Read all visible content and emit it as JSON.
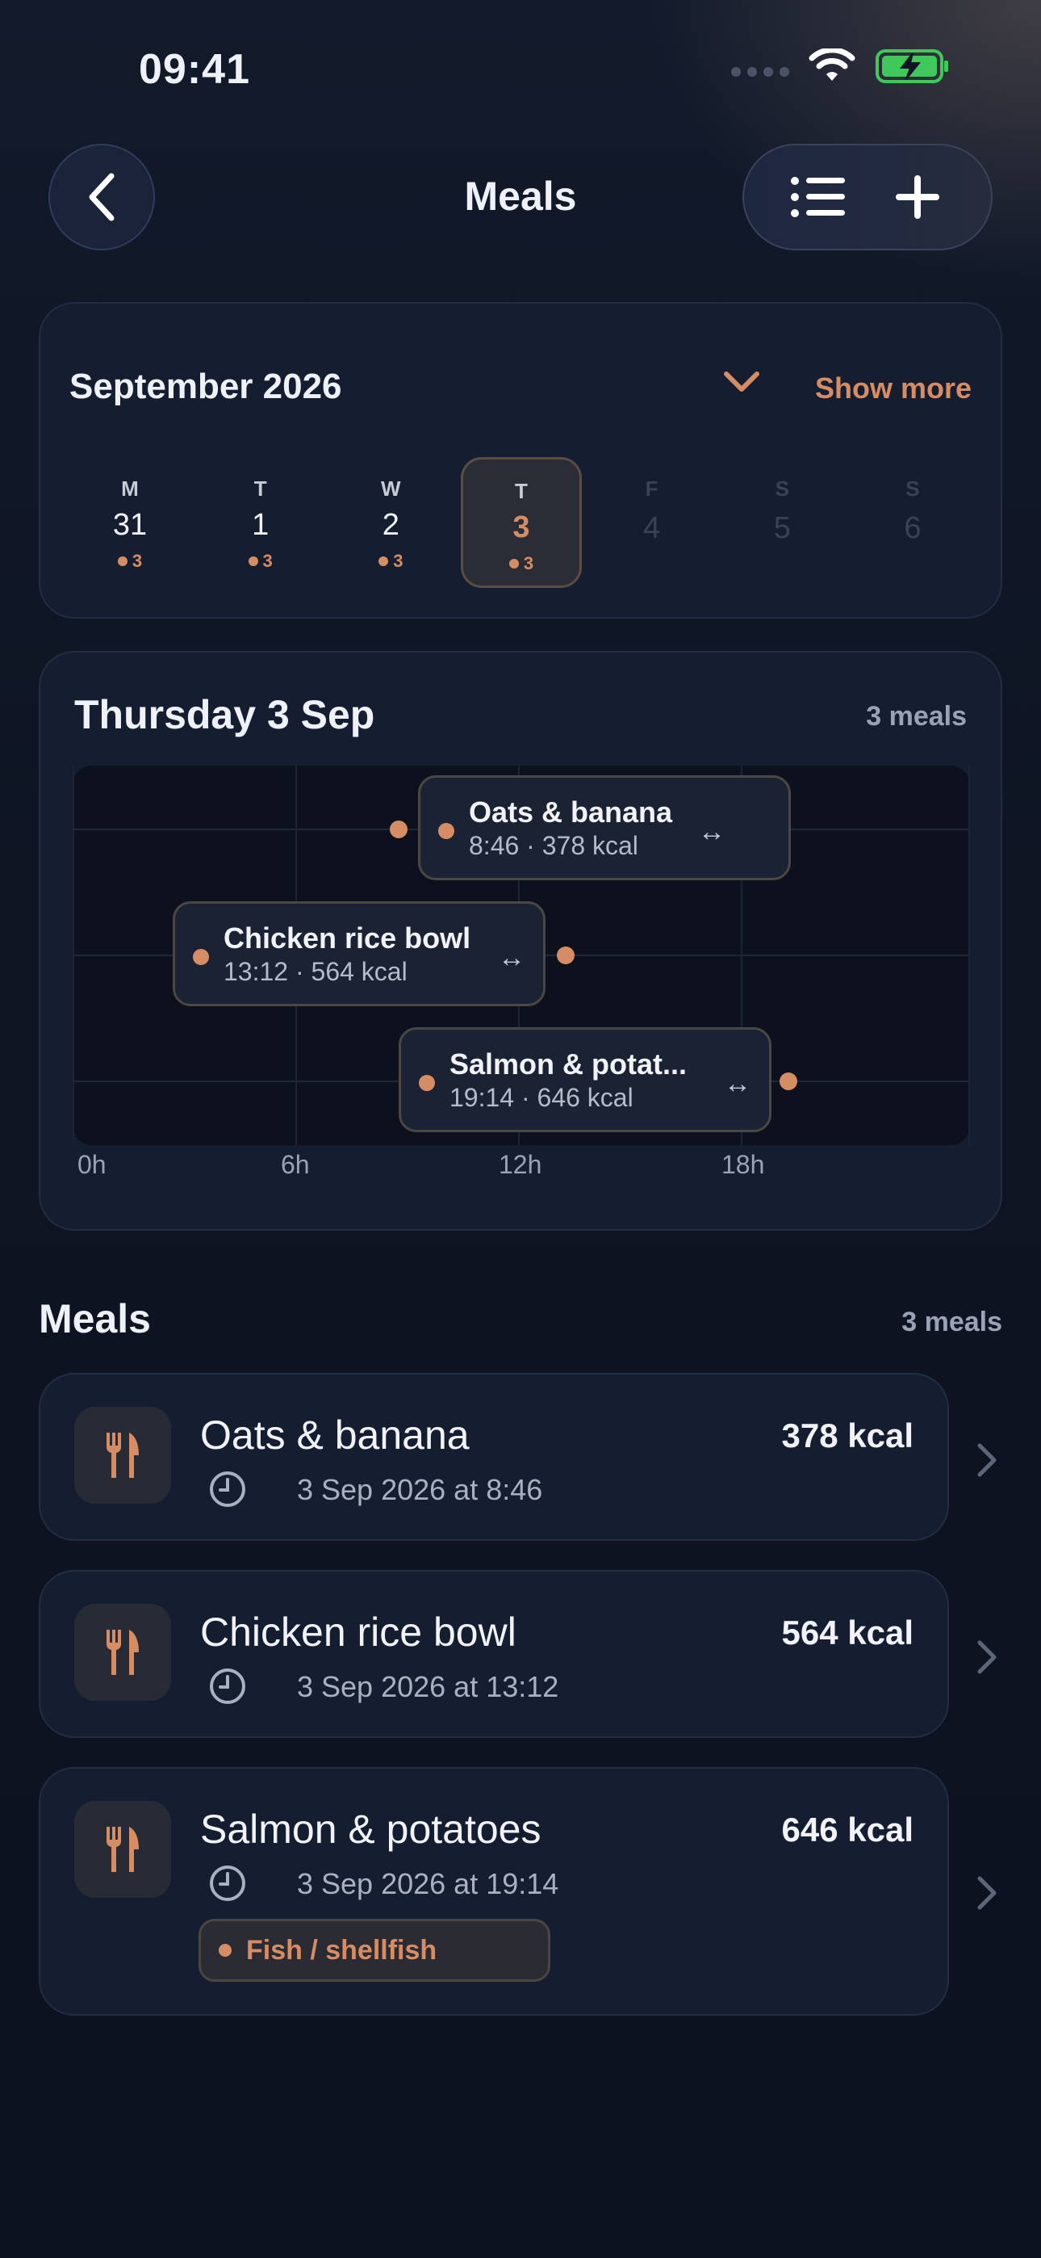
{
  "status_bar": {
    "time": "09:41"
  },
  "nav": {
    "title": "Meals"
  },
  "calendar": {
    "month_title": "September 2026",
    "show_more_label": "Show more",
    "days": [
      {
        "weekday": "M",
        "date": "31",
        "count": "3",
        "state": "past"
      },
      {
        "weekday": "T",
        "date": "1",
        "count": "3",
        "state": "past"
      },
      {
        "weekday": "W",
        "date": "2",
        "count": "3",
        "state": "past"
      },
      {
        "weekday": "T",
        "date": "3",
        "count": "3",
        "state": "selected"
      },
      {
        "weekday": "F",
        "date": "4",
        "count": "",
        "state": "future"
      },
      {
        "weekday": "S",
        "date": "5",
        "count": "",
        "state": "future"
      },
      {
        "weekday": "S",
        "date": "6",
        "count": "",
        "state": "future"
      }
    ]
  },
  "timeline": {
    "title": "Thursday 3 Sep",
    "count_label": "3 meals",
    "axis_labels": [
      "0h",
      "6h",
      "12h",
      "18h"
    ],
    "items": [
      {
        "name": "Oats & banana",
        "detail": "8:46 · 378 kcal"
      },
      {
        "name": "Chicken rice bowl",
        "detail": "13:12 · 564 kcal"
      },
      {
        "name": "Salmon & potat...",
        "detail": "19:14 · 646 kcal"
      }
    ]
  },
  "meals_section": {
    "title": "Meals",
    "count_label": "3 meals",
    "items": [
      {
        "name": "Oats & banana",
        "kcal": "378 kcal",
        "when": "3 Sep 2026 at 8:46",
        "tag": ""
      },
      {
        "name": "Chicken rice bowl",
        "kcal": "564 kcal",
        "when": "3 Sep 2026 at 13:12",
        "tag": ""
      },
      {
        "name": "Salmon & potatoes",
        "kcal": "646 kcal",
        "when": "3 Sep 2026 at 19:14",
        "tag": "Fish / shellfish"
      }
    ]
  },
  "colors": {
    "accent": "#d78d63",
    "background": "#0f1524",
    "card": "#151e30",
    "battery": "#3ec95a"
  },
  "icons": {
    "back": "chevron-left-icon",
    "list": "list-icon",
    "add": "plus-icon",
    "meal": "fork-knife-icon",
    "time": "clock-icon",
    "drag": "horizontal-arrows-icon",
    "row": "chevron-right-icon",
    "expand": "chevron-down-icon"
  }
}
